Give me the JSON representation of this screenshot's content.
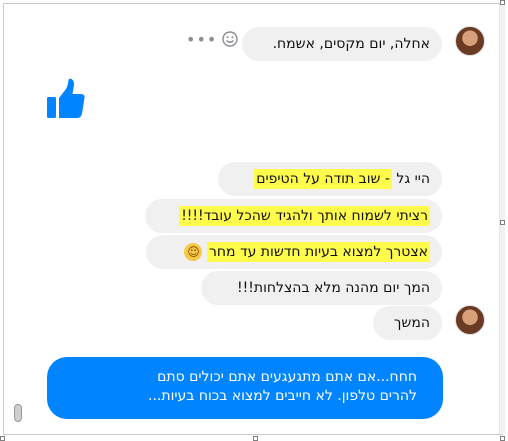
{
  "messages": {
    "incoming_1": "אחלה, יום מקסים, אשמח.",
    "outgoing": [
      {
        "pre": "היי גל ",
        "hl": "- שוב תודה על הטיפים",
        "post": ""
      },
      {
        "pre": "",
        "hl": "רציתי לשמוח אותך ולהגיד שהכל עובד!!!!",
        "post": ""
      },
      {
        "pre": "",
        "hl": "אצטרך למצוא בעיות חדשות עד מחר",
        "post": ""
      },
      {
        "pre": "המך יום מהנה מלא בהצלחות!!!",
        "hl": "",
        "post": ""
      }
    ],
    "incoming_2": "המשך",
    "composer_line1": "חחח...אם אתם מתגעגעים אתם יכולים סתם",
    "composer_line2": "להרים טלפון. לא חייבים למצוא בכוח בעיות..."
  },
  "icons": {
    "like": "thumbs-up-icon",
    "emoji_react": "smiley-icon",
    "more": "more-options-icon",
    "emoji_inline": "smiley-emoji"
  },
  "colors": {
    "accent": "#0084ff",
    "bubble": "#f1f0f0",
    "highlight": "#fffb4d"
  }
}
